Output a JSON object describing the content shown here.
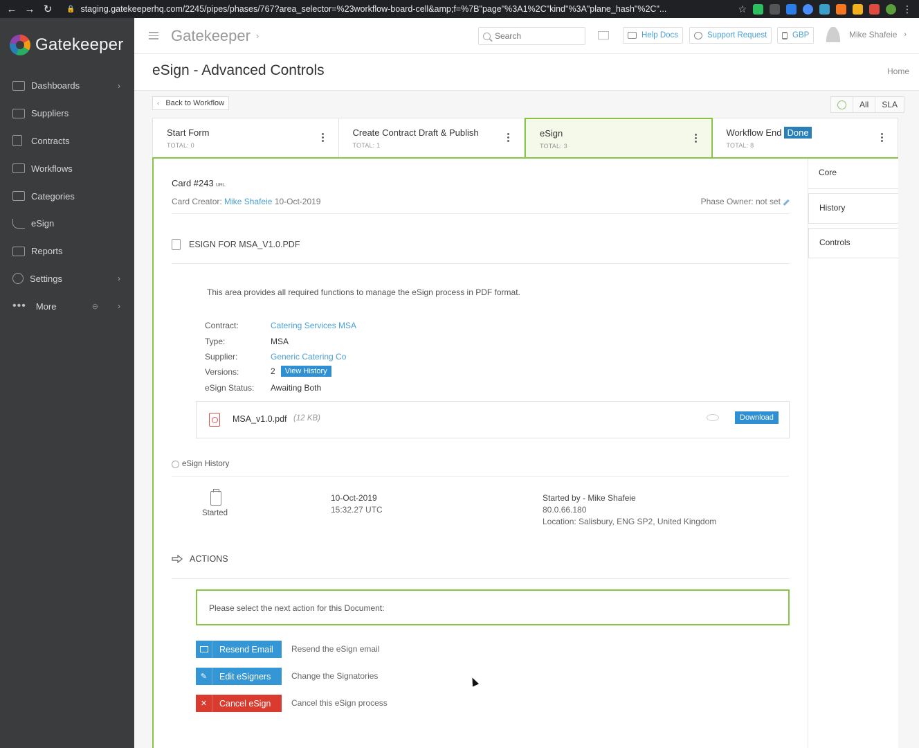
{
  "browser": {
    "url": "staging.gatekeeperhq.com/2245/pipes/phases/767?area_selector=%23workflow-board-cell&amp;f=%7B\"page\"%3A1%2C\"kind\"%3A\"plane_hash\"%2C\"..."
  },
  "brand": {
    "name": "Gatekeeper"
  },
  "sidebar": {
    "items": [
      {
        "label": "Dashboards",
        "icon": "monitor-icon",
        "has_chevron": true
      },
      {
        "label": "Suppliers",
        "icon": "box-icon"
      },
      {
        "label": "Contracts",
        "icon": "document-icon"
      },
      {
        "label": "Workflows",
        "icon": "workflow-grid-icon"
      },
      {
        "label": "Categories",
        "icon": "folder-icon"
      },
      {
        "label": "eSign",
        "icon": "signature-icon"
      },
      {
        "label": "Reports",
        "icon": "bar-chart-icon"
      },
      {
        "label": "Settings",
        "icon": "gear-icon",
        "has_chevron": true
      },
      {
        "label": "More",
        "icon": "ellipsis-icon",
        "has_chevron": true
      }
    ]
  },
  "header": {
    "title": "Gatekeeper",
    "search_placeholder": "Search",
    "help_docs": "Help Docs",
    "support_request": "Support Request",
    "currency": "GBP",
    "user_name": "Mike Shafeie"
  },
  "page": {
    "title": "eSign - Advanced Controls",
    "breadcrumb_home": "Home",
    "back_label": "Back to Workflow",
    "filters": {
      "all": "All",
      "sla": "SLA"
    }
  },
  "phases": [
    {
      "name": "Start Form",
      "total": "TOTAL: 0"
    },
    {
      "name": "Create Contract Draft & Publish",
      "total": "TOTAL: 1"
    },
    {
      "name": "eSign",
      "total": "TOTAL: 3",
      "active": true
    },
    {
      "name": "Workflow End",
      "badge": "Done",
      "total": "TOTAL: 8"
    }
  ],
  "card": {
    "id": "Card #243",
    "url_label": "URL",
    "creator_label": "Card Creator:",
    "creator_name": "Mike Shafeie",
    "created_date": "10-Oct-2019",
    "phase_owner": "Phase Owner: not set",
    "esign_title": "ESIGN FOR MSA_V1.0.PDF",
    "description": "This area provides all required functions to manage the eSign process in PDF format.",
    "fields": {
      "contract_label": "Contract:",
      "contract_value": "Catering Services MSA",
      "type_label": "Type:",
      "type_value": "MSA",
      "supplier_label": "Supplier:",
      "supplier_value": "Generic Catering Co",
      "versions_label": "Versions:",
      "versions_value": "2",
      "view_history": "View History",
      "status_label": "eSign Status:",
      "status_value": "Awaiting Both"
    },
    "file": {
      "name": "MSA_v1.0.pdf",
      "size": "(12 KB)",
      "download": "Download"
    },
    "history": {
      "title": "eSign History",
      "status": "Started",
      "date": "10-Oct-2019",
      "time": "15:32.27 UTC",
      "started_by": "Started by - Mike Shafeie",
      "ip": "80.0.66.180",
      "location": "Location: Salisbury, ENG SP2, United Kingdom"
    },
    "actions": {
      "title": "ACTIONS",
      "prompt": "Please select the next action for this Document:",
      "buttons": [
        {
          "label": "Resend Email",
          "desc": "Resend the eSign email",
          "color": "#3596d6"
        },
        {
          "label": "Edit eSigners",
          "desc": "Change the Signatories",
          "color": "#3596d6"
        },
        {
          "label": "Cancel eSign",
          "desc": "Cancel this eSign process",
          "color": "#d93b2e"
        }
      ]
    }
  },
  "side_tabs": [
    "Core",
    "History",
    "Controls"
  ]
}
